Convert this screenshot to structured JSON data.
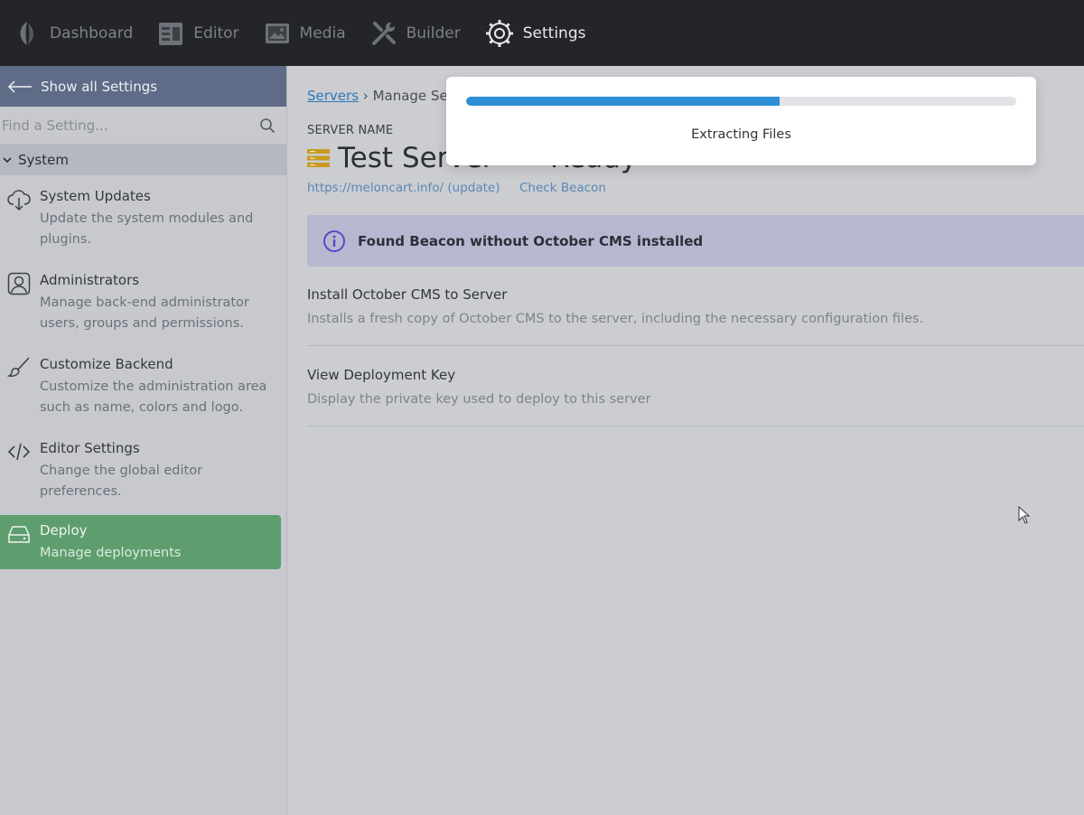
{
  "nav": {
    "items": [
      {
        "label": "Dashboard",
        "icon": "leaf-icon"
      },
      {
        "label": "Editor",
        "icon": "editor-icon"
      },
      {
        "label": "Media",
        "icon": "media-icon"
      },
      {
        "label": "Builder",
        "icon": "tools-icon"
      },
      {
        "label": "Settings",
        "icon": "gear-icon",
        "active": true
      }
    ]
  },
  "sidebar": {
    "back_label": "Show all Settings",
    "search_placeholder": "Find a Setting...",
    "group_label": "System",
    "items": [
      {
        "title": "System Updates",
        "desc": "Update the system modules and plugins.",
        "icon": "cloud-download-icon"
      },
      {
        "title": "Administrators",
        "desc": "Manage back-end administrator users, groups and permissions.",
        "icon": "user-icon"
      },
      {
        "title": "Customize Backend",
        "desc": "Customize the administration area such as name, colors and logo.",
        "icon": "brush-icon"
      },
      {
        "title": "Editor Settings",
        "desc": "Change the global editor preferences.",
        "icon": "code-icon"
      },
      {
        "title": "Deploy",
        "desc": "Manage deployments",
        "icon": "drive-icon",
        "active": true
      }
    ]
  },
  "main": {
    "breadcrumb": {
      "link": "Servers",
      "separator": "›",
      "current": "Manage Server"
    },
    "server_label": "SERVER NAME",
    "server_name": "Test Server",
    "server_url": "https://meloncart.info/ (update)",
    "status": "Ready",
    "check_beacon": "Check Beacon",
    "callout": "Found Beacon without October CMS installed",
    "options": [
      {
        "title": "Install October CMS to Server",
        "desc": "Installs a fresh copy of October CMS to the server, including the necessary configuration files."
      },
      {
        "title": "View Deployment Key",
        "desc": "Display the private key used to deploy to this server"
      }
    ]
  },
  "modal": {
    "progress_fraction": 0.57,
    "text": "Extracting Files"
  },
  "colors": {
    "topnav": "#232528",
    "sidebar_back": "#5f6c88",
    "active_item": "#5e9e6e",
    "progress": "#2f8fd6",
    "status_badge": "#c99a1f",
    "callout": "#b7b8d0"
  }
}
